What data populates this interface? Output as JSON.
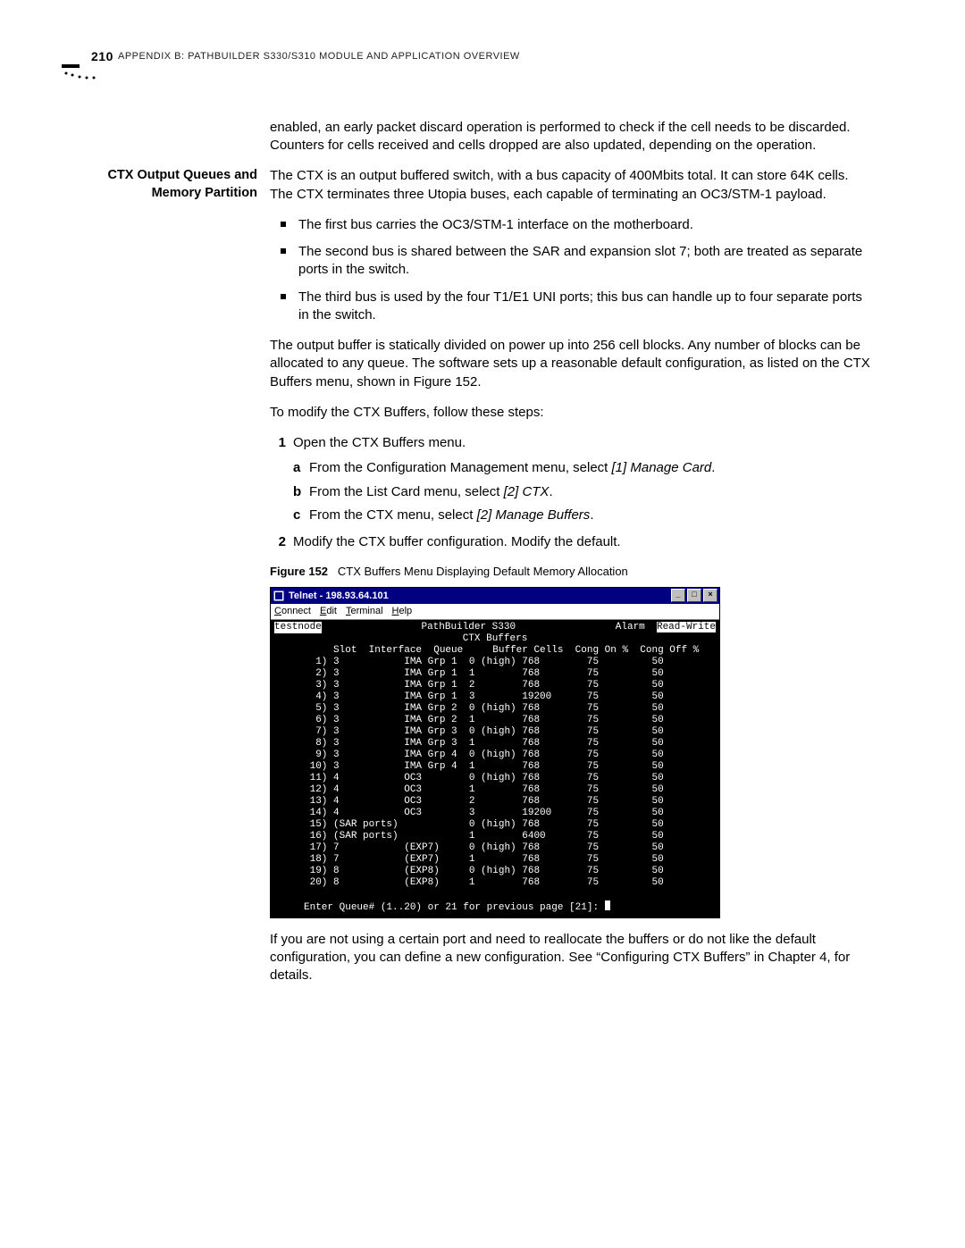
{
  "page_number": "210",
  "running_head": "APPENDIX B: PATHBUILDER S330/S310 MODULE AND APPLICATION OVERVIEW",
  "intro_continuation": "enabled, an early packet discard operation is performed to check if the cell needs to be discarded. Counters for cells received and cells dropped are also updated, depending on the operation.",
  "section": {
    "side_heading_l1": "CTX Output Queues and",
    "side_heading_l2": "Memory Partition",
    "lead": "The CTX is an output buffered switch, with a bus capacity of 400Mbits total. It can store 64K cells. The CTX terminates three Utopia buses, each capable of terminating an OC3/STM-1 payload.",
    "bullets": [
      "The first bus carries the OC3/STM-1 interface on the motherboard.",
      "The second bus is shared between the SAR and expansion slot 7; both are treated as separate ports in the switch.",
      "The third bus is used by the four T1/E1 UNI ports; this bus can handle up to four separate ports in the switch."
    ],
    "after_bullets": "The output buffer is statically divided on power up into 256 cell blocks. Any number of blocks can be allocated to any queue. The software sets up a reasonable default configuration, as listed on the CTX Buffers menu, shown in Figure 152.",
    "steps_intro": "To modify the CTX Buffers, follow these steps:",
    "steps": [
      {
        "n": "1",
        "text": "Open the CTX Buffers menu.",
        "subs": [
          {
            "l": "a",
            "plain": "From the Configuration Management menu, select ",
            "ital": "[1] Manage Card",
            "tail": "."
          },
          {
            "l": "b",
            "plain": "From the List Card menu, select ",
            "ital": "[2] CTX",
            "tail": "."
          },
          {
            "l": "c",
            "plain": "From the CTX menu, select ",
            "ital": "[2] Manage Buffers",
            "tail": "."
          }
        ]
      },
      {
        "n": "2",
        "text": "Modify the CTX buffer configuration. Modify the default."
      }
    ],
    "figure": {
      "label": "Figure 152",
      "caption": "CTX Buffers Menu Displaying Default Memory Allocation"
    },
    "after_figure": "If you are not using a certain port and need to reallocate the buffers or do not like the default configuration, you can define a new configuration. See “Configuring CTX Buffers” in Chapter 4, for details."
  },
  "telnet": {
    "title": "Telnet - 198.93.64.101",
    "menus": [
      "Connect",
      "Edit",
      "Terminal",
      "Help"
    ],
    "status_left": "testnode",
    "status_mid": "PathBuilder S330",
    "status_right_1": "Alarm",
    "status_right_2": "Read-Write",
    "subtitle": "CTX Buffers",
    "columns": [
      "Slot",
      "Interface",
      "Queue",
      "Buffer Cells",
      "Cong On %",
      "Cong Off %"
    ],
    "rows": [
      {
        "n": "1)",
        "slot": "3",
        "intf": "IMA Grp 1",
        "queue": "0 (high)",
        "buf": "768",
        "on": "75",
        "off": "50"
      },
      {
        "n": "2)",
        "slot": "3",
        "intf": "IMA Grp 1",
        "queue": "1",
        "buf": "768",
        "on": "75",
        "off": "50"
      },
      {
        "n": "3)",
        "slot": "3",
        "intf": "IMA Grp 1",
        "queue": "2",
        "buf": "768",
        "on": "75",
        "off": "50"
      },
      {
        "n": "4)",
        "slot": "3",
        "intf": "IMA Grp 1",
        "queue": "3",
        "buf": "19200",
        "on": "75",
        "off": "50"
      },
      {
        "n": "5)",
        "slot": "3",
        "intf": "IMA Grp 2",
        "queue": "0 (high)",
        "buf": "768",
        "on": "75",
        "off": "50"
      },
      {
        "n": "6)",
        "slot": "3",
        "intf": "IMA Grp 2",
        "queue": "1",
        "buf": "768",
        "on": "75",
        "off": "50"
      },
      {
        "n": "7)",
        "slot": "3",
        "intf": "IMA Grp 3",
        "queue": "0 (high)",
        "buf": "768",
        "on": "75",
        "off": "50"
      },
      {
        "n": "8)",
        "slot": "3",
        "intf": "IMA Grp 3",
        "queue": "1",
        "buf": "768",
        "on": "75",
        "off": "50"
      },
      {
        "n": "9)",
        "slot": "3",
        "intf": "IMA Grp 4",
        "queue": "0 (high)",
        "buf": "768",
        "on": "75",
        "off": "50"
      },
      {
        "n": "10)",
        "slot": "3",
        "intf": "IMA Grp 4",
        "queue": "1",
        "buf": "768",
        "on": "75",
        "off": "50"
      },
      {
        "n": "11)",
        "slot": "4",
        "intf": "OC3",
        "queue": "0 (high)",
        "buf": "768",
        "on": "75",
        "off": "50"
      },
      {
        "n": "12)",
        "slot": "4",
        "intf": "OC3",
        "queue": "1",
        "buf": "768",
        "on": "75",
        "off": "50"
      },
      {
        "n": "13)",
        "slot": "4",
        "intf": "OC3",
        "queue": "2",
        "buf": "768",
        "on": "75",
        "off": "50"
      },
      {
        "n": "14)",
        "slot": "4",
        "intf": "OC3",
        "queue": "3",
        "buf": "19200",
        "on": "75",
        "off": "50"
      },
      {
        "n": "15)",
        "slot": "(SAR ports)",
        "intf": "",
        "queue": "0 (high)",
        "buf": "768",
        "on": "75",
        "off": "50"
      },
      {
        "n": "16)",
        "slot": "(SAR ports)",
        "intf": "",
        "queue": "1",
        "buf": "6400",
        "on": "75",
        "off": "50"
      },
      {
        "n": "17)",
        "slot": "7",
        "intf": "(EXP7)",
        "queue": "0 (high)",
        "buf": "768",
        "on": "75",
        "off": "50"
      },
      {
        "n": "18)",
        "slot": "7",
        "intf": "(EXP7)",
        "queue": "1",
        "buf": "768",
        "on": "75",
        "off": "50"
      },
      {
        "n": "19)",
        "slot": "8",
        "intf": "(EXP8)",
        "queue": "0 (high)",
        "buf": "768",
        "on": "75",
        "off": "50"
      },
      {
        "n": "20)",
        "slot": "8",
        "intf": "(EXP8)",
        "queue": "1",
        "buf": "768",
        "on": "75",
        "off": "50"
      }
    ],
    "prompt": "Enter Queue# (1..20) or 21 for previous page [21]: "
  }
}
